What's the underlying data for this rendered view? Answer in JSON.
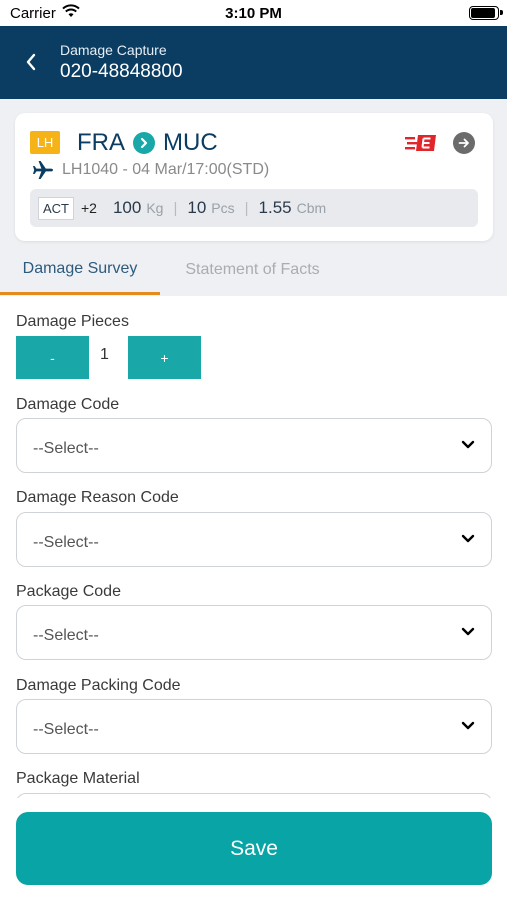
{
  "status_bar": {
    "carrier": "Carrier",
    "time": "3:10 PM"
  },
  "header": {
    "subtitle": "Damage Capture",
    "title": "020-48848800"
  },
  "flight": {
    "airline": "LH",
    "origin": "FRA",
    "destination": "MUC",
    "flight_info": "LH1040 - 04 Mar/17:00(STD)",
    "status": "ACT",
    "extra": "+2",
    "weight": "100",
    "weight_unit": "Kg",
    "pieces": "10",
    "pieces_unit": "Pcs",
    "volume": "1.55",
    "volume_unit": "Cbm",
    "sep": "|",
    "accent_color": "#19a7a8",
    "badge_color": "#f5b317"
  },
  "tabs": [
    {
      "label": "Damage Survey",
      "active": true
    },
    {
      "label": "Statement of Facts",
      "active": false
    }
  ],
  "form": {
    "damage_pieces": {
      "label": "Damage Pieces",
      "minus": "-",
      "plus": "+",
      "value": "1"
    },
    "fields": [
      {
        "label": "Damage Code",
        "placeholder": "--Select--"
      },
      {
        "label": "Damage Reason Code",
        "placeholder": "--Select--"
      },
      {
        "label": "Package Code",
        "placeholder": "--Select--"
      },
      {
        "label": "Damage Packing Code",
        "placeholder": "--Select--"
      },
      {
        "label": "Package Material",
        "placeholder": ""
      }
    ]
  },
  "save_label": "Save",
  "colors": {
    "header_bg": "#0b3d62",
    "teal": "#09a4a6",
    "tab_underline": "#e58b1e"
  }
}
